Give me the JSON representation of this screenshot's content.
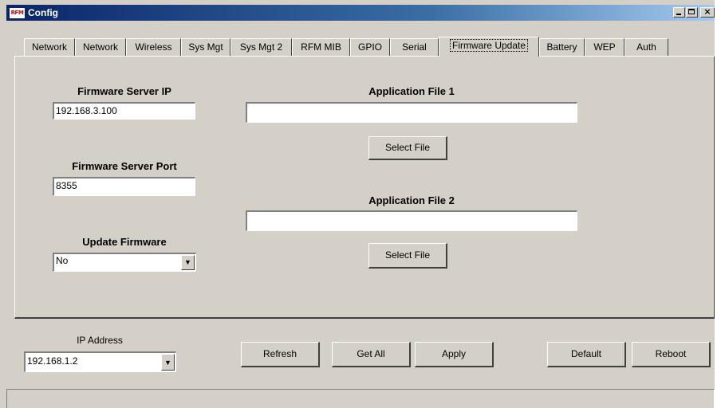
{
  "window": {
    "title": "Config",
    "icon_text": "RFM",
    "min_glyph": "",
    "max_glyph": "",
    "close_glyph": "×"
  },
  "tabs": [
    {
      "label": "Network"
    },
    {
      "label": "Network"
    },
    {
      "label": "Wireless"
    },
    {
      "label": "Sys Mgt"
    },
    {
      "label": "Sys Mgt 2"
    },
    {
      "label": "RFM MIB"
    },
    {
      "label": "GPIO"
    },
    {
      "label": "Serial"
    },
    {
      "label": "Firmware Update"
    },
    {
      "label": "Battery"
    },
    {
      "label": "WEP"
    },
    {
      "label": "Auth"
    }
  ],
  "active_tab": "Firmware Update",
  "firmware": {
    "server_ip_label": "Firmware Server IP",
    "server_ip_value": "192.168.3.100",
    "server_port_label": "Firmware Server Port",
    "server_port_value": "8355",
    "update_label": "Update Firmware",
    "update_value": "No",
    "app_file1_label": "Application File 1",
    "app_file1_value": "",
    "app_file2_label": "Application File 2",
    "app_file2_value": "",
    "select_file_label": "Select File"
  },
  "footer": {
    "ip_label": "IP Address",
    "ip_value": "192.168.1.2",
    "refresh": "Refresh",
    "get_all": "Get All",
    "apply": "Apply",
    "default": "Default",
    "reboot": "Reboot"
  },
  "icons": {
    "dropdown_arrow": "▼"
  }
}
